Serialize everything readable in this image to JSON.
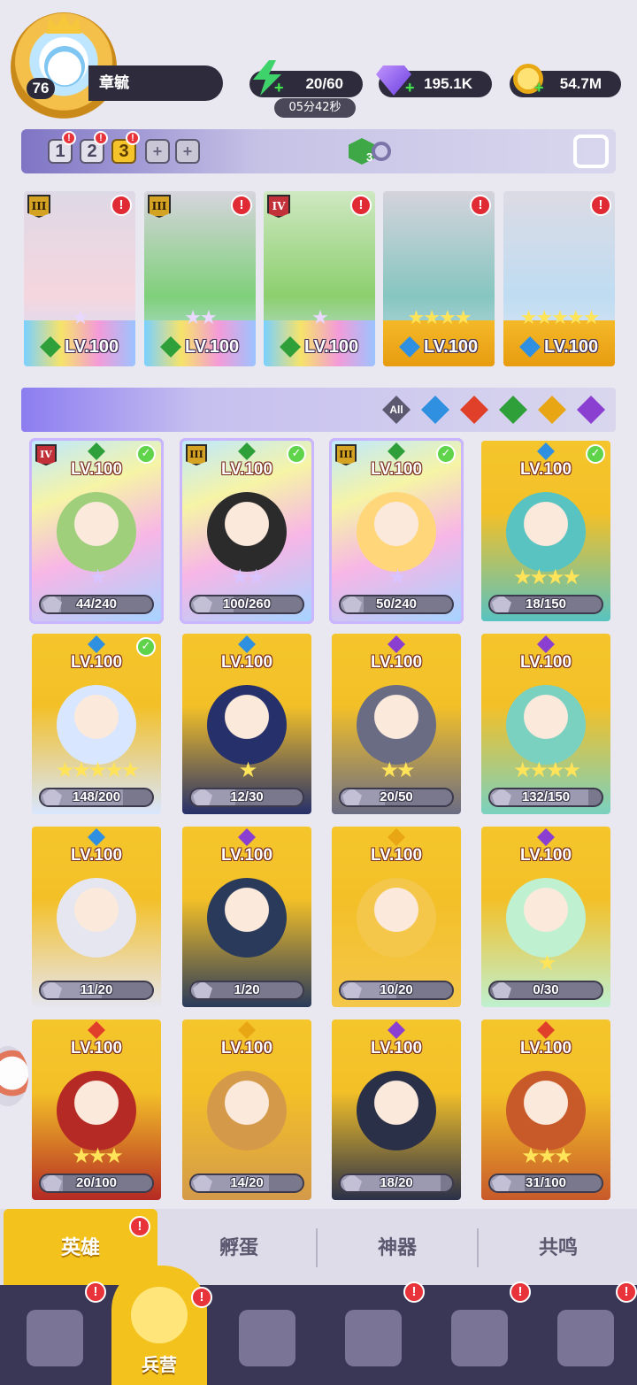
{
  "player": {
    "level": "76",
    "name": "章毓"
  },
  "resources": {
    "energy": "20/60",
    "energy_timer": "05分42秒",
    "gems": "195.1K",
    "gold": "54.7M"
  },
  "teams": {
    "slots": [
      "1",
      "2",
      "3"
    ],
    "active_index": 2,
    "add_label": "+",
    "dice_count": "3"
  },
  "lineup": [
    {
      "rank": "III",
      "rank_color": "gold",
      "level": "LV.100",
      "element": "nature",
      "stars": "★",
      "alert": "!"
    },
    {
      "rank": "III",
      "rank_color": "gold",
      "level": "LV.100",
      "element": "nature",
      "stars": "★★",
      "alert": "!"
    },
    {
      "rank": "IV",
      "rank_color": "red",
      "level": "LV.100",
      "element": "nature",
      "stars": "★",
      "alert": "!"
    },
    {
      "rank": "",
      "rank_color": "",
      "level": "LV.100",
      "element": "water",
      "stars": "★★★★",
      "alert": "!"
    },
    {
      "rank": "",
      "rank_color": "",
      "level": "LV.100",
      "element": "water",
      "stars": "★★★★★",
      "alert": "!"
    }
  ],
  "filters": {
    "all_label": "All",
    "elements": [
      "water",
      "fire",
      "nature",
      "light",
      "dark"
    ],
    "colors": {
      "water": "#2f8fe0",
      "fire": "#e0402a",
      "nature": "#2f9f3a",
      "light": "#e8a514",
      "dark": "#8a3fd0"
    }
  },
  "heroes": [
    {
      "level": "LV.100",
      "element": "nature",
      "rank": "IV",
      "rank_color": "red",
      "checked": true,
      "selected": true,
      "stars": "★",
      "progress": "44/240",
      "fraction": 0.18
    },
    {
      "level": "LV.100",
      "element": "nature",
      "rank": "III",
      "rank_color": "gold",
      "checked": true,
      "selected": true,
      "stars": "★★",
      "progress": "100/260",
      "fraction": 0.38
    },
    {
      "level": "LV.100",
      "element": "nature",
      "rank": "III",
      "rank_color": "gold",
      "checked": true,
      "selected": true,
      "stars": "★",
      "progress": "50/240",
      "fraction": 0.21
    },
    {
      "level": "LV.100",
      "element": "water",
      "rank": "",
      "rank_color": "",
      "checked": true,
      "selected": false,
      "stars": "★★★★",
      "progress": "18/150",
      "fraction": 0.12
    },
    {
      "level": "LV.100",
      "element": "water",
      "rank": "",
      "rank_color": "",
      "checked": true,
      "selected": false,
      "stars": "★★★★★",
      "progress": "148/200",
      "fraction": 0.74
    },
    {
      "level": "LV.100",
      "element": "water",
      "rank": "",
      "rank_color": "",
      "checked": false,
      "selected": false,
      "stars": "★",
      "progress": "12/30",
      "fraction": 0.4
    },
    {
      "level": "LV.100",
      "element": "dark",
      "rank": "",
      "rank_color": "",
      "checked": false,
      "selected": false,
      "stars": "★★",
      "progress": "20/50",
      "fraction": 0.4
    },
    {
      "level": "LV.100",
      "element": "dark",
      "rank": "",
      "rank_color": "",
      "checked": false,
      "selected": false,
      "stars": "★★★★",
      "progress": "132/150",
      "fraction": 0.88
    },
    {
      "level": "LV.100",
      "element": "water",
      "rank": "",
      "rank_color": "",
      "checked": false,
      "selected": false,
      "stars": "",
      "progress": "11/20",
      "fraction": 0.55
    },
    {
      "level": "LV.100",
      "element": "dark",
      "rank": "",
      "rank_color": "",
      "checked": false,
      "selected": false,
      "stars": "",
      "progress": "1/20",
      "fraction": 0.05
    },
    {
      "level": "LV.100",
      "element": "light",
      "rank": "",
      "rank_color": "",
      "checked": false,
      "selected": false,
      "stars": "",
      "progress": "10/20",
      "fraction": 0.5
    },
    {
      "level": "LV.100",
      "element": "dark",
      "rank": "",
      "rank_color": "",
      "checked": false,
      "selected": false,
      "stars": "★",
      "progress": "0/30",
      "fraction": 0.0
    },
    {
      "level": "LV.100",
      "element": "fire",
      "rank": "",
      "rank_color": "",
      "checked": false,
      "selected": false,
      "stars": "★★★",
      "progress": "20/100",
      "fraction": 0.2
    },
    {
      "level": "LV.100",
      "element": "light",
      "rank": "",
      "rank_color": "",
      "checked": false,
      "selected": false,
      "stars": "",
      "progress": "14/20",
      "fraction": 0.7
    },
    {
      "level": "LV.100",
      "element": "dark",
      "rank": "",
      "rank_color": "",
      "checked": false,
      "selected": false,
      "stars": "",
      "progress": "18/20",
      "fraction": 0.9
    },
    {
      "level": "LV.100",
      "element": "fire",
      "rank": "",
      "rank_color": "",
      "checked": false,
      "selected": false,
      "stars": "★★★",
      "progress": "31/100",
      "fraction": 0.31
    }
  ],
  "subtabs": {
    "heroes": "英雄",
    "incubate": "孵蛋",
    "artifact": "神器",
    "resonance": "共鸣"
  },
  "bottomnav": {
    "items": [
      "cards-icon",
      "barracks-icon",
      "map-icon",
      "castle-icon",
      "mushroom-icon",
      "guild-icon"
    ],
    "active_label": "兵营"
  }
}
